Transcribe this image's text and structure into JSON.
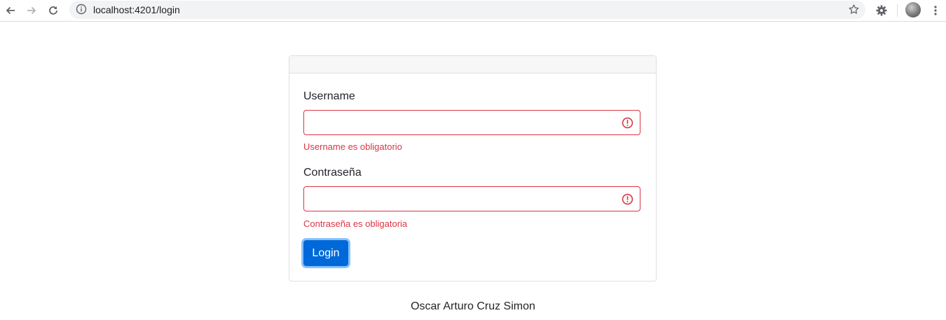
{
  "browser": {
    "url": "localhost:4201/login"
  },
  "login_form": {
    "username_label": "Username",
    "username_value": "",
    "username_error": "Username es obligatorio",
    "password_label": "Contraseña",
    "password_value": "",
    "password_error": "Contraseña es obligatoria",
    "login_button": "Login"
  },
  "footer": {
    "author": "Oscar Arturo Cruz Simon"
  },
  "colors": {
    "error": "#dc3545",
    "primary": "#0069d9"
  },
  "icons": [
    "back-arrow-icon",
    "forward-arrow-icon",
    "reload-icon",
    "info-icon",
    "star-icon",
    "extension-gear-icon",
    "profile-avatar-icon",
    "menu-kebab-icon",
    "error-icon"
  ]
}
